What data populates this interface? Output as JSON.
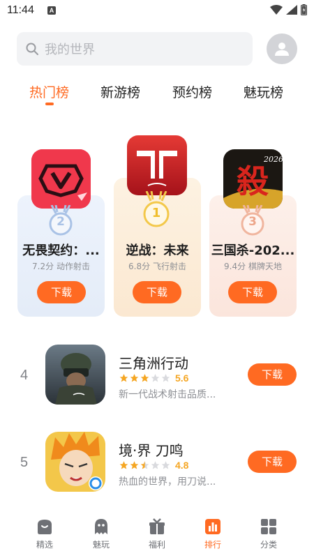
{
  "status_bar": {
    "time": "11:44",
    "a_badge": "A"
  },
  "search": {
    "placeholder": "我的世界"
  },
  "tabs": [
    {
      "label": "热门榜",
      "active": true
    },
    {
      "label": "新游榜",
      "active": false
    },
    {
      "label": "预约榜",
      "active": false
    },
    {
      "label": "魅玩榜",
      "active": false
    }
  ],
  "podium": [
    {
      "rank": "2",
      "title": "无畏契约：...",
      "score": "7.2分",
      "genre": "动作射击",
      "button": "下载",
      "card_color": "#e9f0fb",
      "medal_color": "#a9c2e6",
      "icon_name": "valorant-icon"
    },
    {
      "rank": "1",
      "title": "逆战：未来",
      "score": "6.8分",
      "genre": "飞行射击",
      "button": "下载",
      "card_color": "#fdf1e0",
      "medal_color": "#f3c84a",
      "icon_name": "nizhan-icon"
    },
    {
      "rank": "3",
      "title": "三国杀-202...",
      "score": "9.4分",
      "genre": "棋牌天地",
      "button": "下载",
      "card_color": "#fdeee8",
      "medal_color": "#f0b59e",
      "icon_name": "sanguosha-icon",
      "icon_badge": "2026",
      "icon_glyph": "殺"
    }
  ],
  "list": [
    {
      "rank": "4",
      "title": "三角洲行动",
      "rating": 5.6,
      "rating_text": "5.6",
      "desc": "新一代战术射击品质...",
      "button": "下载",
      "icon_name": "delta-force-icon"
    },
    {
      "rank": "5",
      "title": "境·界 刀鸣",
      "rating": 4.8,
      "rating_text": "4.8",
      "desc": "热血的世界，用刀说...",
      "button": "下载",
      "icon_name": "bleach-icon"
    }
  ],
  "bottom_nav": [
    {
      "label": "精选",
      "icon": "featured-icon",
      "active": false
    },
    {
      "label": "魅玩",
      "icon": "ghost-icon",
      "active": false
    },
    {
      "label": "福利",
      "icon": "gift-icon",
      "active": false
    },
    {
      "label": "排行",
      "icon": "ranking-icon",
      "active": true
    },
    {
      "label": "分类",
      "icon": "category-icon",
      "active": false
    }
  ],
  "colors": {
    "accent": "#ff6a22",
    "star": "#f5a623",
    "star_empty": "#d9dade"
  }
}
